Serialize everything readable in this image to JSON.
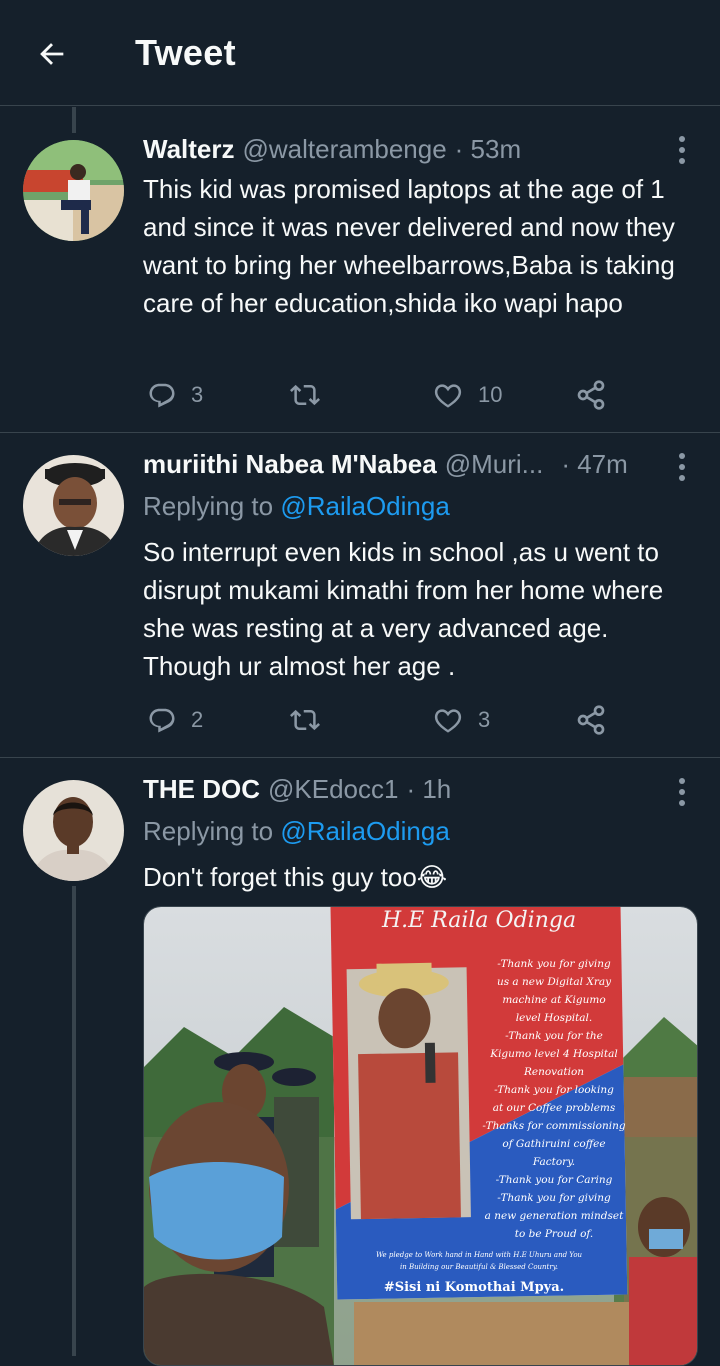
{
  "header": {
    "title": "Tweet"
  },
  "tweets": [
    {
      "name": "Walterz",
      "handle": "@walterambenge",
      "time": "· 53m",
      "replying_prefix": "",
      "replying_to": "",
      "text": "This kid was promised laptops at the age of 1 and since it was never delivered and now they want to bring her wheelbarrows,Baba is taking care of her education,shida iko wapi hapo",
      "replies": "3",
      "retweets": "",
      "likes": "10"
    },
    {
      "name": "muriithi Nabea M'Nabea",
      "handle": "@Muri...",
      "time": "· 47m",
      "replying_prefix": "Replying to ",
      "replying_to": "@RailaOdinga",
      "text": "So  interrupt even kids in school ,as u went to disrupt mukami kimathi from her home where she was resting at a very advanced age. Though ur almost  her age .",
      "replies": "2",
      "retweets": "",
      "likes": "3"
    },
    {
      "name": "THE DOC",
      "handle": "@KEdocc1",
      "time": "· 1h",
      "replying_prefix": "Replying to ",
      "replying_to": "@RailaOdinga",
      "text": "Don't forget this guy too😂",
      "media_poster": {
        "header": "H.E Raila Odinga",
        "lines": [
          "-Thank you for giving",
          "us a new Digital Xray",
          "machine at Kigumo",
          "level Hospital.",
          "-Thank you for the",
          "Kigumo level 4 Hospital",
          "Renovation",
          "-Thank you for looking",
          "at our Coffee problems",
          "-Thanks for commissioning",
          "of Gathiruini coffee",
          "Factory.",
          "-Thank you for Caring",
          "-Thank you for giving",
          "a new generation mindset",
          "to be Proud of."
        ],
        "pledge_1": "We pledge to Work hand in Hand with H.E Uhuru and You",
        "pledge_2": "in Building our Beautiful & Blessed Country.",
        "slogan": "#Sisi ni Komothai Mpya."
      }
    }
  ],
  "icons": [
    "back-arrow-icon",
    "reply-icon",
    "retweet-icon",
    "like-icon",
    "share-icon",
    "more-icon"
  ],
  "colors": {
    "background": "#15202b",
    "divider": "#38444d",
    "muted": "#8b98a5",
    "accent": "#1d9bf0"
  }
}
